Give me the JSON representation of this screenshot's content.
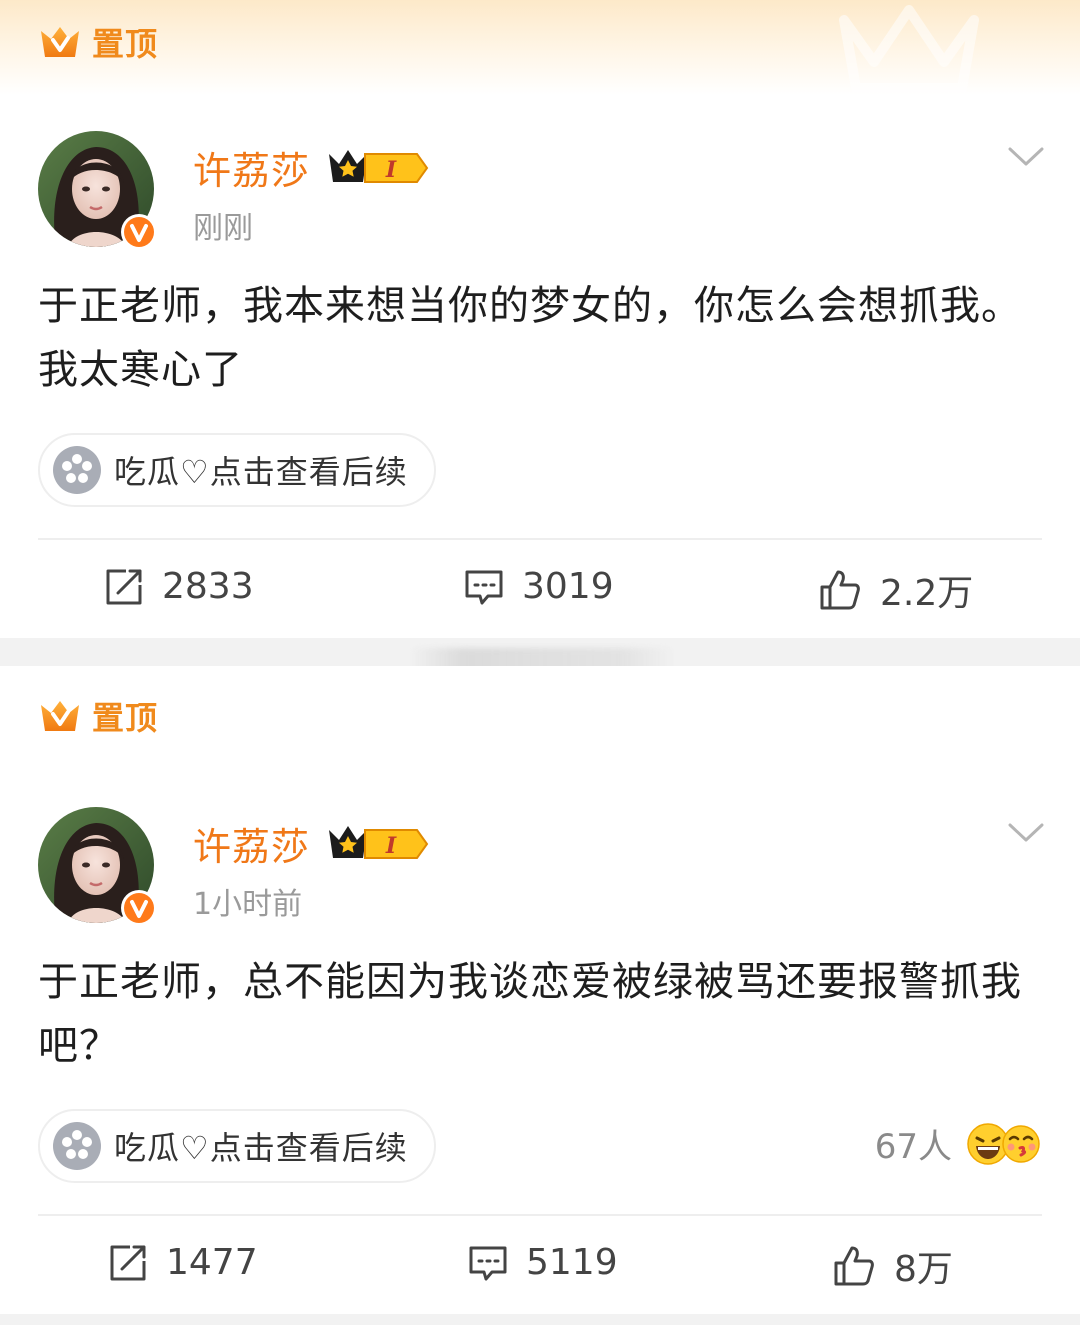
{
  "colors": {
    "accent": "#f07818",
    "pin": "#f08a1c",
    "verified": "#ff7a1a",
    "muted": "#9a9a9a"
  },
  "posts": [
    {
      "pin_label": "置顶",
      "author": "许荔莎",
      "vip_level": "I",
      "time": "刚刚",
      "content": "于正老师，我本来想当你的梦女的，你怎么会想抓我。我太寒心了",
      "topic": "吃瓜♡点击查看后续",
      "reposts": "2833",
      "comments": "3019",
      "likes": "2.2万"
    },
    {
      "pin_label": "置顶",
      "author": "许荔莎",
      "vip_level": "I",
      "time": "1小时前",
      "content": "于正老师，总不能因为我谈恋爱被绿被骂还要报警抓我吧？",
      "topic": "吃瓜♡点击查看后续",
      "reaction_count": "67人",
      "reposts": "1477",
      "comments": "5119",
      "likes": "8万"
    }
  ],
  "icons": [
    "pin-crown-icon",
    "verified-v-icon",
    "vip-crown-icon",
    "chevron-down-icon",
    "topic-flower-icon",
    "repost-icon",
    "comment-icon",
    "like-icon",
    "laugh-emoji-icon",
    "kiss-emoji-icon"
  ]
}
